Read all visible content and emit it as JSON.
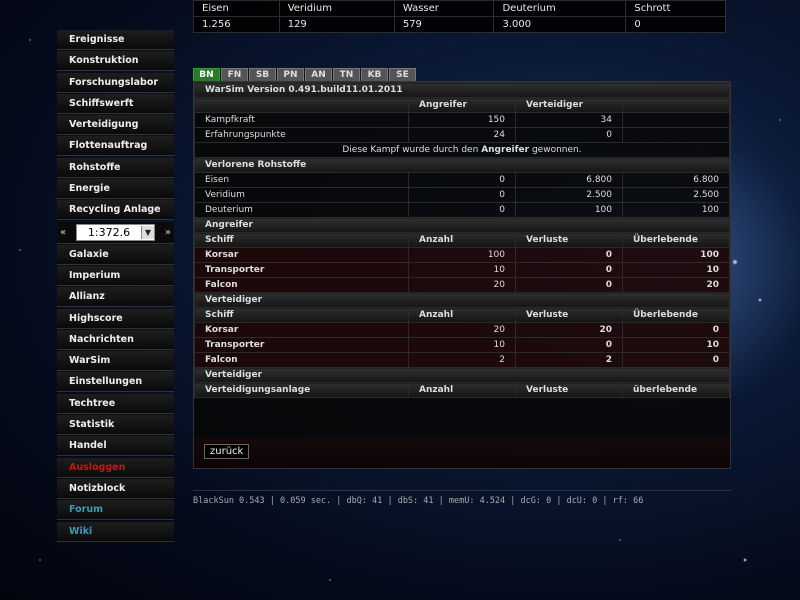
{
  "resources": {
    "headers": [
      "Eisen",
      "Veridium",
      "Wasser",
      "Deuterium",
      "Schrott"
    ],
    "values": [
      "1.256",
      "129",
      "579",
      "3.000",
      "0"
    ]
  },
  "nav": {
    "items_top": [
      "Ereignisse",
      "Konstruktion",
      "Forschungslabor",
      "Schiffswerft",
      "Verteidigung",
      "Flottenauftrag",
      "Rohstoffe",
      "Energie",
      "Recycling Anlage"
    ],
    "zoom_value": "1:372.6",
    "zoom_prev": "«",
    "zoom_next": "»",
    "items_bottom": [
      "Galaxie",
      "Imperium",
      "Allianz",
      "Highscore",
      "Nachrichten",
      "WarSim",
      "Einstellungen",
      "Techtree",
      "Statistik",
      "Handel"
    ],
    "logout": "Ausloggen",
    "notes": "Notizblock",
    "forum": "Forum",
    "wiki": "Wiki"
  },
  "tabs": [
    "BN",
    "FN",
    "SB",
    "PN",
    "AN",
    "TN",
    "KB",
    "SE"
  ],
  "report": {
    "title": "WarSim Version 0.491.build11.01.2011",
    "col_attacker": "Angreifer",
    "col_defender": "Verteidiger",
    "stats": [
      {
        "label": "Kampfkraft",
        "a": "150",
        "d": "34"
      },
      {
        "label": "Erfahrungspunkte",
        "a": "24",
        "d": "0"
      }
    ],
    "result_pre": "Diese Kampf wurde durch den",
    "result_winner": "Angreifer",
    "result_post": "gewonnen.",
    "lost_title": "Verlorene Rohstoffe",
    "lost": [
      {
        "label": "Eisen",
        "v1": "0",
        "v2": "6.800",
        "v3": "6.800"
      },
      {
        "label": "Veridium",
        "v1": "0",
        "v2": "2.500",
        "v3": "2.500"
      },
      {
        "label": "Deuterium",
        "v1": "0",
        "v2": "100",
        "v3": "100"
      }
    ],
    "attacker_title": "Angreifer",
    "cols": {
      "ship": "Schiff",
      "count": "Anzahl",
      "losses": "Verluste",
      "survivors": "Überlebende"
    },
    "attacker_ships": [
      {
        "name": "Korsar",
        "count": "100",
        "loss": "0",
        "surv": "100"
      },
      {
        "name": "Transporter",
        "count": "10",
        "loss": "0",
        "surv": "10"
      },
      {
        "name": "Falcon",
        "count": "20",
        "loss": "0",
        "surv": "20"
      }
    ],
    "defender_title": "Verteidiger",
    "defender_ships": [
      {
        "name": "Korsar",
        "count": "20",
        "loss": "20",
        "surv": "0"
      },
      {
        "name": "Transporter",
        "count": "10",
        "loss": "0",
        "surv": "10"
      },
      {
        "name": "Falcon",
        "count": "2",
        "loss": "2",
        "surv": "0"
      }
    ],
    "defense_title": "Verteidiger",
    "defense_cols": {
      "name": "Verteidigungsanlage",
      "count": "Anzahl",
      "losses": "Verluste",
      "survivors": "überlebende"
    },
    "back_label": "zurück"
  },
  "status": "BlackSun 0.543 | 0.059 sec. | dbQ: 41 | dbS: 41 | memU: 4.524 | dcG: 0 | dcU: 0 | rf: 66"
}
